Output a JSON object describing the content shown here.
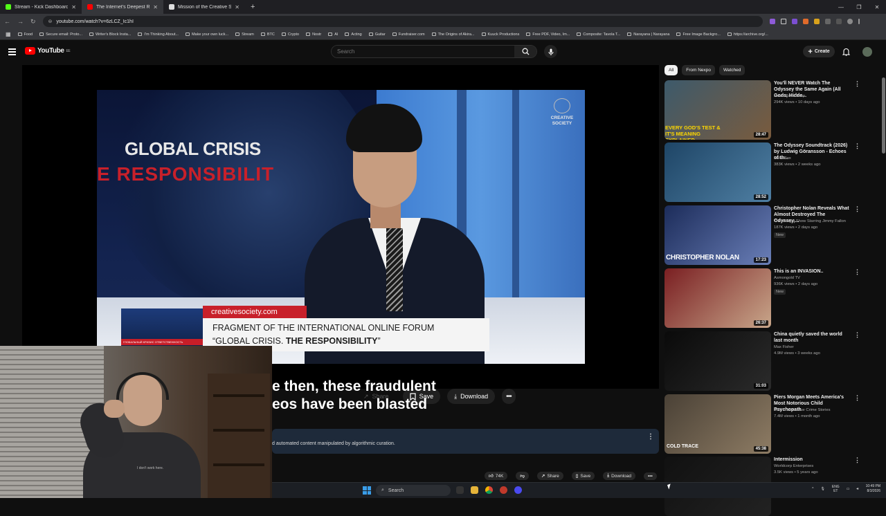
{
  "browser": {
    "tabs": [
      {
        "title": "Stream - Kick Dashboard",
        "color": "#53fc18",
        "active": false
      },
      {
        "title": "The Internet's Deepest Rab",
        "color": "#ff0000",
        "active": true
      },
      {
        "title": "Mission of the Creative Society",
        "color": "#dddddd",
        "active": false
      }
    ],
    "url": "youtube.com/watch?v=6zLCZ_Ic1hI",
    "bookmarks": [
      "Food",
      "Secure email: Proto...",
      "Writer's Block Insta...",
      "I'm Thinking About...",
      "Make your own luck...",
      "Stream",
      "BTC",
      "Crypto",
      "Nostr",
      "AI",
      "Acting",
      "Guitar",
      "Fundraiser.com",
      "The Origins of Akira...",
      "Kuuck Productions",
      "Free PDF, Video, Im...",
      "Composite: Tavola T...",
      "Narayana | Narayana",
      "Free Image Backgro...",
      "https://archive.org/..."
    ]
  },
  "youtube": {
    "logo_text": "YouTube",
    "region": "EE",
    "search_placeholder": "Search",
    "create_label": "Create"
  },
  "video": {
    "title_line1": "GLOBAL CRISIS",
    "title_line2": "E RESPONSIBILIT",
    "brand": "CREATIVE SOCIETY",
    "site": "creativesociety.com",
    "fragment_line1": "FRAGMENT OF THE INTERNATIONAL ONLINE FORUM",
    "fragment_line2_a": "“GLOBAL CRISIS. ",
    "fragment_line2_b": "THE RESPONSIBILITY",
    "fragment_line2_c": "”",
    "thumb_line1": "ГЛОБАЛЬНЫЙ КРИЗИС ОТВЕТСТВЕННОСТЬ",
    "thumb_line2": "2 декабря 2023 | 17:00 ГМТ"
  },
  "captions": {
    "line1": "e then, these fraudulent",
    "line2": "eos have been blasted"
  },
  "actions": {
    "share": "Share",
    "save": "Save",
    "download": "Download"
  },
  "description": {
    "text": "d automated content manipulated by algorithmic curation."
  },
  "actions_bottom": {
    "likes": "74K",
    "share": "Share",
    "save": "Save",
    "download": "Download"
  },
  "webcam": {
    "shirt_text": "I don't work here."
  },
  "taskbar": {
    "search": "Search",
    "lang": "ENG",
    "lang2": "ET",
    "time": "10:49 PM",
    "date": "8/3/2026"
  },
  "chips": [
    "All",
    "From Nexpo",
    "Watched"
  ],
  "recommendations": [
    {
      "title": "You'll NEVER Watch The Odyssey the Same Again (All Gods, Hidde...",
      "channel": "Movie Balls Deep",
      "meta": "294K views • 10 days ago",
      "duration": "28:47",
      "thumb_text": "EVERY GOD'S TEST & IT'S MEANING EXPLAINED",
      "badge": "",
      "colors": [
        "#3d5a6b",
        "#7a5b3d"
      ]
    },
    {
      "title": "The Odyssey Soundtrack (2026) by Ludwig Göransson - Echoes of th...",
      "channel": "Kaka Box",
      "meta": "383K views • 2 weeks ago",
      "duration": "28:52",
      "thumb_text": "",
      "badge": "",
      "colors": [
        "#1e4566",
        "#4f7fa3"
      ]
    },
    {
      "title": "Christopher Nolan Reveals What Almost Destroyed The Odyssey,...",
      "channel": "The Tonight Show Starring Jimmy Fallon",
      "meta": "187K views • 2 days ago",
      "duration": "17:23",
      "thumb_text": "CHRISTOPHER NOLAN",
      "badge": "New",
      "colors": [
        "#1c2c5a",
        "#6a7fb8"
      ]
    },
    {
      "title": "This is an INVASION..",
      "channel": "Asmongold TV",
      "meta": "936K views • 2 days ago",
      "duration": "26:37",
      "thumb_text": "",
      "badge": "New",
      "colors": [
        "#7a1f22",
        "#c8a68a"
      ]
    },
    {
      "title": "China quietly saved the world last month",
      "channel": "Max Fisher",
      "meta": "4.9M views • 3 weeks ago",
      "duration": "31:03",
      "thumb_text": "",
      "badge": "",
      "colors": [
        "#0a0a0a",
        "#2b2b2b"
      ]
    },
    {
      "title": "Piers Morgan Meets America's Most Notorious Child Psychopath",
      "channel": "Cold Trace - True Crime Stories",
      "meta": "7.4M views • 1 month ago",
      "duration": "45:38",
      "thumb_text": "COLD TRACE",
      "badge": "",
      "colors": [
        "#4a4136",
        "#8e7c64"
      ]
    },
    {
      "title": "Intermission",
      "channel": "Worldcorp Enterprises",
      "meta": "3.5K views • 5 years ago",
      "duration": "",
      "thumb_text": "",
      "badge": "",
      "colors": [
        "#111111",
        "#222222"
      ]
    }
  ]
}
